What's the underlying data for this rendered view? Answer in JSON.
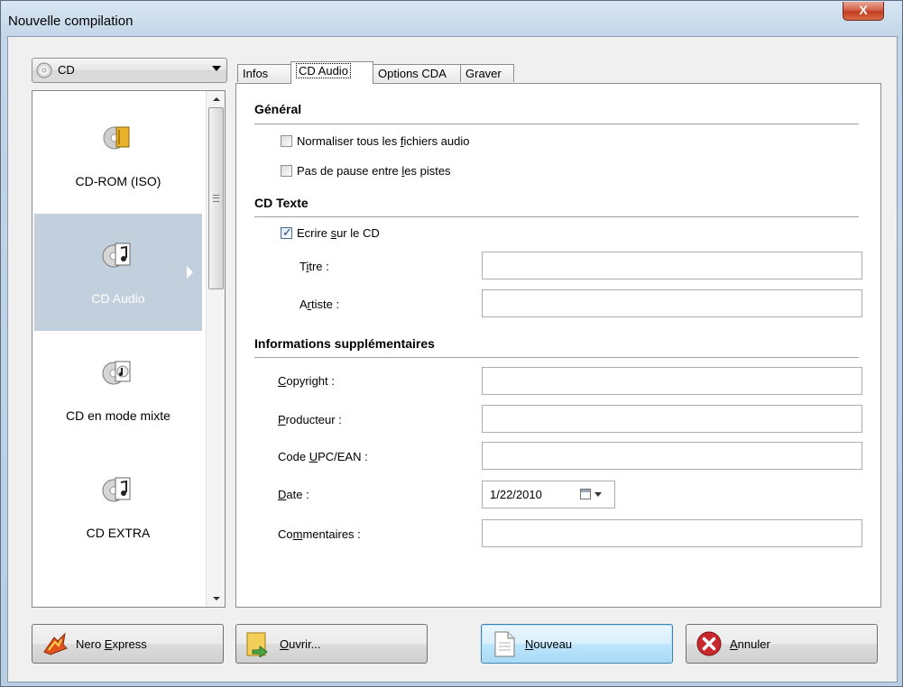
{
  "window": {
    "title": "Nouvelle compilation",
    "close_glyph": "X"
  },
  "media_dropdown": {
    "value": "CD",
    "icon": "cd-disc-icon"
  },
  "left_list": {
    "items": [
      {
        "label": "CD-ROM (ISO)",
        "icon": "cd-rom-iso-icon",
        "selected": false
      },
      {
        "label": "CD Audio",
        "icon": "cd-audio-icon",
        "selected": true
      },
      {
        "label": "CD en mode mixte",
        "icon": "cd-mixed-mode-icon",
        "selected": false
      },
      {
        "label": "CD EXTRA",
        "icon": "cd-extra-icon",
        "selected": false
      }
    ]
  },
  "tabs": [
    {
      "label": "Infos",
      "active": false
    },
    {
      "label": "CD Audio",
      "active": true
    },
    {
      "label": "Options CDA",
      "active": false
    },
    {
      "label": "Graver",
      "active": false
    }
  ],
  "general": {
    "heading": "Général",
    "normalize": {
      "label_pre": "Normaliser tous les ",
      "label_u": "f",
      "label_post": "ichiers audio",
      "checked": false
    },
    "no_pause": {
      "label_pre": "Pas de pause entre ",
      "label_u": "l",
      "label_post": "es pistes",
      "checked": false
    }
  },
  "cd_text": {
    "heading": "CD Texte",
    "write": {
      "label_pre": "Ecrire ",
      "label_u": "s",
      "label_post": "ur le CD",
      "checked": true
    },
    "title": {
      "label_pre": "T",
      "label_u": "i",
      "label_post": "tre :",
      "value": ""
    },
    "artist": {
      "label_pre": "A",
      "label_u": "r",
      "label_post": "tiste :",
      "value": ""
    }
  },
  "extra_info": {
    "heading": "Informations supplémentaires",
    "copyright": {
      "label_pre": "",
      "label_u": "C",
      "label_post": "opyright :",
      "value": ""
    },
    "producer": {
      "label_pre": "",
      "label_u": "P",
      "label_post": "roducteur :",
      "value": ""
    },
    "upc": {
      "label_pre": "Code ",
      "label_u": "U",
      "label_post": "PC/EAN :",
      "value": ""
    },
    "date": {
      "label_pre": "",
      "label_u": "D",
      "label_post": "ate :",
      "value": "1/22/2010"
    },
    "comments": {
      "label_pre": "Co",
      "label_u": "m",
      "label_post": "mentaires :",
      "value": ""
    }
  },
  "buttons": {
    "nero_express": {
      "label_pre": "Nero ",
      "label_u": "E",
      "label_post": "xpress",
      "icon": "nero-express-icon"
    },
    "open": {
      "label_pre": "",
      "label_u": "O",
      "label_post": "uvrir...",
      "icon": "open-folder-icon"
    },
    "new": {
      "label_pre": "",
      "label_u": "N",
      "label_post": "ouveau",
      "icon": "new-document-icon"
    },
    "cancel": {
      "label_pre": "",
      "label_u": "A",
      "label_post": "nnuler",
      "icon": "cancel-x-icon"
    }
  },
  "colors": {
    "selection": "#c2cfdc",
    "close_button": "#c33d20",
    "default_button": "#3c7fb1"
  }
}
